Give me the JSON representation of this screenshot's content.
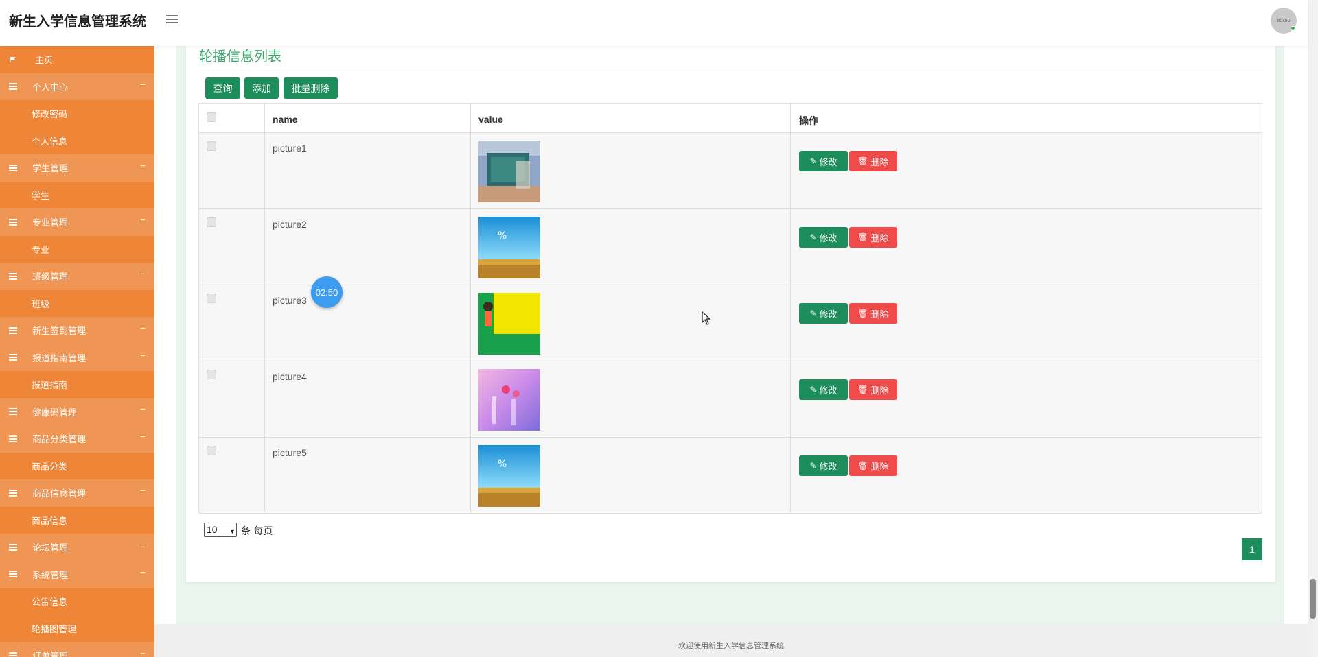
{
  "header": {
    "title": "新生入学信息管理系统",
    "avatar_text": "80x80"
  },
  "sidebar": {
    "items": [
      {
        "label": "主页",
        "type": "home",
        "icon": "flag-icon"
      },
      {
        "label": "个人中心",
        "type": "group",
        "icon": "bars-icon"
      },
      {
        "label": "修改密码",
        "type": "child"
      },
      {
        "label": "个人信息",
        "type": "child"
      },
      {
        "label": "学生管理",
        "type": "group",
        "icon": "bars-icon"
      },
      {
        "label": "学生",
        "type": "child"
      },
      {
        "label": "专业管理",
        "type": "group",
        "icon": "bars-icon"
      },
      {
        "label": "专业",
        "type": "child"
      },
      {
        "label": "班级管理",
        "type": "group",
        "icon": "bars-icon"
      },
      {
        "label": "班级",
        "type": "child"
      },
      {
        "label": "新生签到管理",
        "type": "group",
        "icon": "bars-icon"
      },
      {
        "label": "报道指南管理",
        "type": "group",
        "icon": "bars-icon"
      },
      {
        "label": "报道指南",
        "type": "child"
      },
      {
        "label": "健康码管理",
        "type": "group",
        "icon": "bars-icon"
      },
      {
        "label": "商品分类管理",
        "type": "group",
        "icon": "bars-icon"
      },
      {
        "label": "商品分类",
        "type": "child"
      },
      {
        "label": "商品信息管理",
        "type": "group",
        "icon": "bars-icon"
      },
      {
        "label": "商品信息",
        "type": "child"
      },
      {
        "label": "论坛管理",
        "type": "group",
        "icon": "bars-icon"
      },
      {
        "label": "系统管理",
        "type": "group",
        "icon": "bars-icon"
      },
      {
        "label": "公告信息",
        "type": "child"
      },
      {
        "label": "轮播图管理",
        "type": "child"
      },
      {
        "label": "订单管理",
        "type": "group",
        "icon": "bars-icon"
      }
    ]
  },
  "main": {
    "title": "轮播信息列表",
    "buttons": {
      "query": "查询",
      "add": "添加",
      "batch_delete": "批量删除"
    },
    "table": {
      "headers": {
        "name": "name",
        "value": "value",
        "actions": "操作"
      },
      "rows": [
        {
          "name": "picture1",
          "thumb": "photo-room"
        },
        {
          "name": "picture2",
          "thumb": "photo-wheat-sky"
        },
        {
          "name": "picture3",
          "thumb": "photo-yellow-green"
        },
        {
          "name": "picture4",
          "thumb": "photo-pink-purple"
        },
        {
          "name": "picture5",
          "thumb": "photo-wheat-sky"
        }
      ],
      "edit_label": "修改",
      "delete_label": "删除"
    },
    "pagination": {
      "page_size": "10",
      "page_size_label": "条 每页",
      "current_page": "1"
    }
  },
  "footer": {
    "text": "欢迎使用新生入学信息管理系统"
  },
  "overlay": {
    "timer": "02:50"
  },
  "colors": {
    "sidebar": "#ee8537",
    "sidebar_group": "#f09655",
    "primary": "#1c8d5b",
    "danger": "#f04b4b",
    "title_green": "#3aa76d",
    "content_bg": "#e9f5ee"
  }
}
